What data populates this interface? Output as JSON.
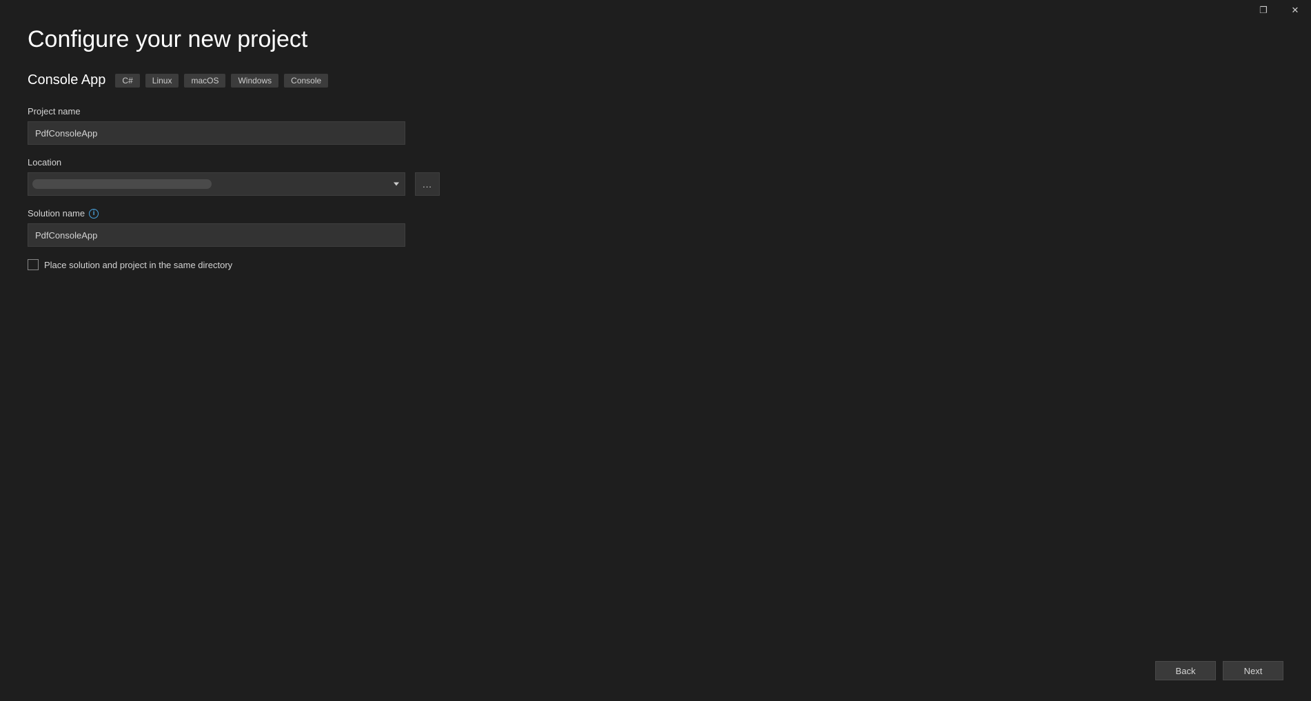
{
  "window": {
    "maximize_glyph": "❐",
    "close_glyph": "✕"
  },
  "header": {
    "title": "Configure your new project",
    "template_name": "Console App",
    "tags": [
      "C#",
      "Linux",
      "macOS",
      "Windows",
      "Console"
    ]
  },
  "fields": {
    "project_name": {
      "label": "Project name",
      "value": "PdfConsoleApp"
    },
    "location": {
      "label": "Location",
      "value": "",
      "browse_label": "..."
    },
    "solution_name": {
      "label": "Solution name",
      "info_glyph": "i",
      "value": "PdfConsoleApp"
    },
    "same_directory": {
      "label": "Place solution and project in the same directory",
      "checked": false
    }
  },
  "footer": {
    "back_label": "Back",
    "next_label": "Next"
  }
}
